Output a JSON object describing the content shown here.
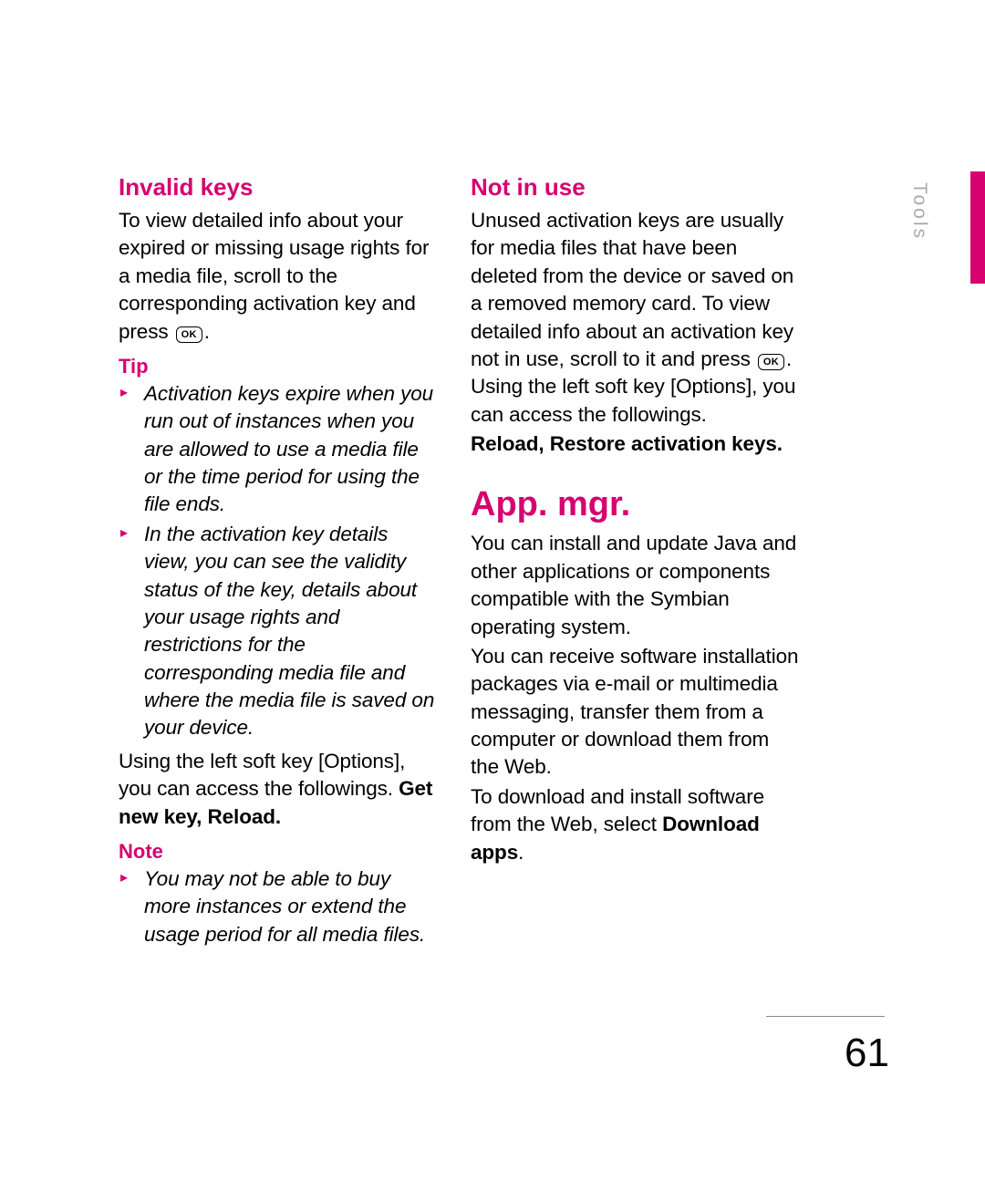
{
  "section_label": "Tools",
  "page_number": "61",
  "ok_label": "OK",
  "left": {
    "h_invalid": "Invalid keys",
    "p_invalid_a": "To view detailed info about your expired or missing usage rights for a media file, scroll to the corresponding activation key and press ",
    "p_invalid_b": ".",
    "tip_label": "Tip",
    "tip1": "Activation keys expire when you run out of instances when you are allowed to use a media file or the time period for using the file ends.",
    "tip2": "In the activation key details view, you can see the validity status of the key, details about your usage rights and restrictions for the corresponding media file and where the media file is saved on your device.",
    "after_tip_a": "Using the left soft key [Options], you can access the followings. ",
    "after_tip_bold": "Get new key, Reload.",
    "note_label": "Note",
    "note1": "You may not be able to buy more instances or extend the usage period for all media files."
  },
  "right": {
    "h_notinuse": "Not in use",
    "p_niu_a": "Unused activation keys are usually for media files that have been deleted from the device or saved on a removed memory card. To view detailed info about an activation key not in use, scroll to it and press ",
    "p_niu_b": ". Using the left soft key [Options], you can access the followings.",
    "niu_bold": "Reload, Restore activation keys.",
    "h_appmgr": "App. mgr.",
    "p_app1": "You can install and update Java and other applications or components compatible with the Symbian operating system.",
    "p_app2": "You can receive software installation packages via e-mail or multimedia messaging, transfer them from a computer or download them from the Web.",
    "p_app3_a": "To download and install software from the Web, select ",
    "p_app3_bold": "Download apps",
    "p_app3_b": "."
  }
}
